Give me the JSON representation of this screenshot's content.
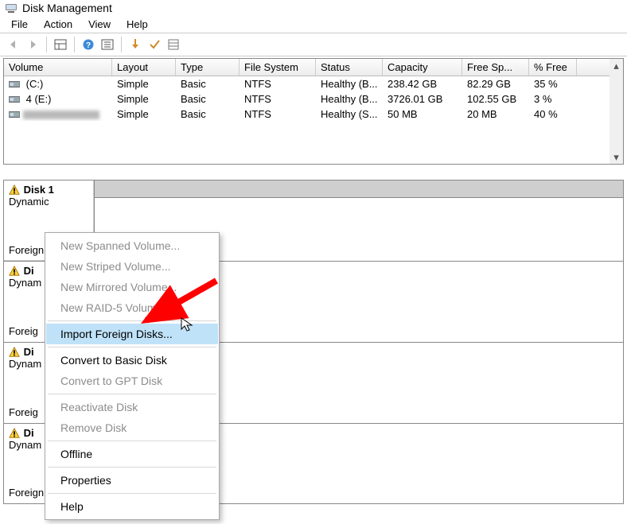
{
  "title": "Disk Management",
  "menubar": [
    "File",
    "Action",
    "View",
    "Help"
  ],
  "vol_headers": {
    "volume": "Volume",
    "layout": "Layout",
    "type": "Type",
    "fs": "File System",
    "status": "Status",
    "capacity": "Capacity",
    "free": "Free Sp...",
    "pct": "% Free"
  },
  "volumes": [
    {
      "name": "(C:)",
      "layout": "Simple",
      "type": "Basic",
      "fs": "NTFS",
      "status": "Healthy (B...",
      "capacity": "238.42 GB",
      "free": "82.29 GB",
      "pct": "35 %"
    },
    {
      "name": "4 (E:)",
      "layout": "Simple",
      "type": "Basic",
      "fs": "NTFS",
      "status": "Healthy (B...",
      "capacity": "3726.01 GB",
      "free": "102.55 GB",
      "pct": "3 %"
    },
    {
      "name": "",
      "layout": "Simple",
      "type": "Basic",
      "fs": "NTFS",
      "status": "Healthy (S...",
      "capacity": "50 MB",
      "free": "20 MB",
      "pct": "40 %",
      "blur": true
    }
  ],
  "disks": [
    {
      "name": "Disk 1",
      "status": "Dynamic",
      "foreign": "Foreign"
    },
    {
      "name": "Di",
      "status": "Dynam",
      "foreign": "Foreig"
    },
    {
      "name": "Di",
      "status": "Dynam",
      "foreign": "Foreig"
    },
    {
      "name": "Di",
      "status": "Dynam",
      "foreign": "Foreign"
    }
  ],
  "ctx": {
    "items": [
      {
        "label": "New Spanned Volume...",
        "disabled": true
      },
      {
        "label": "New Striped Volume...",
        "disabled": true
      },
      {
        "label": "New Mirrored Volume...",
        "disabled": true
      },
      {
        "label": "New RAID-5 Volume...",
        "disabled": true
      },
      {
        "sep": true
      },
      {
        "label": "Import Foreign Disks...",
        "hl": true
      },
      {
        "sep": true
      },
      {
        "label": "Convert to Basic Disk"
      },
      {
        "label": "Convert to GPT Disk",
        "disabled": true
      },
      {
        "sep": true
      },
      {
        "label": "Reactivate Disk",
        "disabled": true
      },
      {
        "label": "Remove Disk",
        "disabled": true
      },
      {
        "sep": true
      },
      {
        "label": "Offline"
      },
      {
        "sep": true
      },
      {
        "label": "Properties"
      },
      {
        "sep": true
      },
      {
        "label": "Help"
      }
    ]
  }
}
